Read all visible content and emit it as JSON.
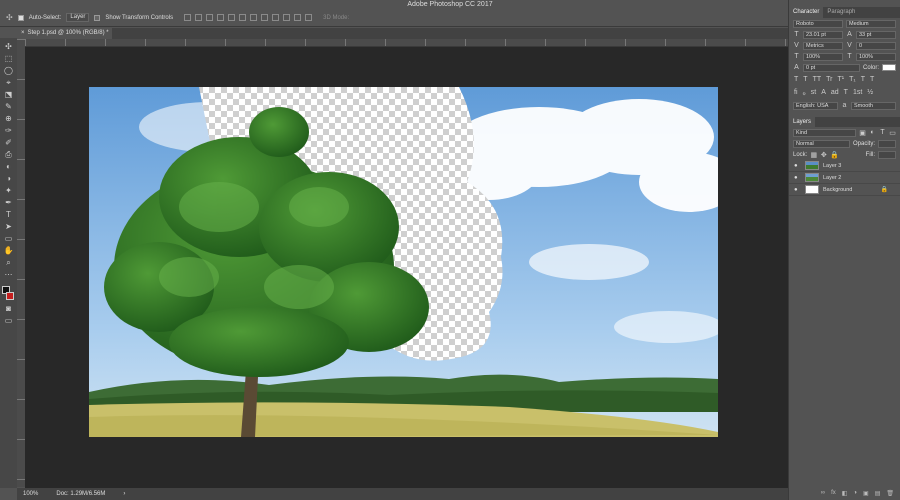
{
  "window": {
    "title": "Adobe Photoshop CC 2017"
  },
  "options_bar": {
    "move_icon": "✣",
    "auto_select_label": "Auto-Select:",
    "auto_select_mode": "Layer",
    "transform_label": "Show Transform Controls",
    "mode_3d_label": "3D Mode:"
  },
  "document_tab": {
    "title": "Step 1.psd @ 100% (RGB/8) *",
    "close": "×"
  },
  "tools": [
    "✣",
    "⬚",
    "◯",
    "⌖",
    "⬔",
    "✎",
    "⊕",
    "✑",
    "✐",
    "⎙",
    "◐",
    "◑",
    "✦",
    "✒",
    "T",
    "➤",
    "▭",
    "✋",
    "⌕",
    "⋯"
  ],
  "status_bar": {
    "zoom": "100%",
    "doc": "Doc: 1.29M/6.56M",
    "arrow": "›"
  },
  "character_panel": {
    "tabs": [
      "Character",
      "Paragraph"
    ],
    "font_family": "Roboto",
    "font_style": "Medium",
    "font_size": "23.01 pt",
    "leading": "33 pt",
    "kerning": "Metrics",
    "tracking": "0",
    "vertical_scale": "100%",
    "horizontal_scale": "100%",
    "baseline_shift": "0 pt",
    "color_label": "Color:",
    "type_styles": [
      "T",
      "T",
      "TT",
      "Tr",
      "T¹",
      "T₁",
      "T",
      "T"
    ],
    "opentype": [
      "fi",
      "ℴ",
      "st",
      "A",
      "ad",
      "T",
      "1st",
      "½"
    ],
    "language": "English: USA",
    "aa_label": "a",
    "antialias": "Smooth"
  },
  "layers_panel": {
    "tab": "Layers",
    "filter_kind": "Kind",
    "blend_mode": "Normal",
    "opacity_label": "Opacity:",
    "lock_label": "Lock:",
    "fill_label": "Fill:",
    "layers": [
      {
        "name": "Layer 3",
        "visible": true,
        "thumb": "t3"
      },
      {
        "name": "Layer 2",
        "visible": true,
        "thumb": "t2"
      },
      {
        "name": "Background",
        "visible": true,
        "thumb": "tb",
        "locked": true
      }
    ],
    "footer_icons": [
      "∞",
      "fx",
      "◧",
      "◑",
      "▣",
      "▤",
      "🗑"
    ]
  },
  "colors": {
    "foreground": "#111111",
    "background": "#c51f1f",
    "canvas_bg": "#282828"
  }
}
